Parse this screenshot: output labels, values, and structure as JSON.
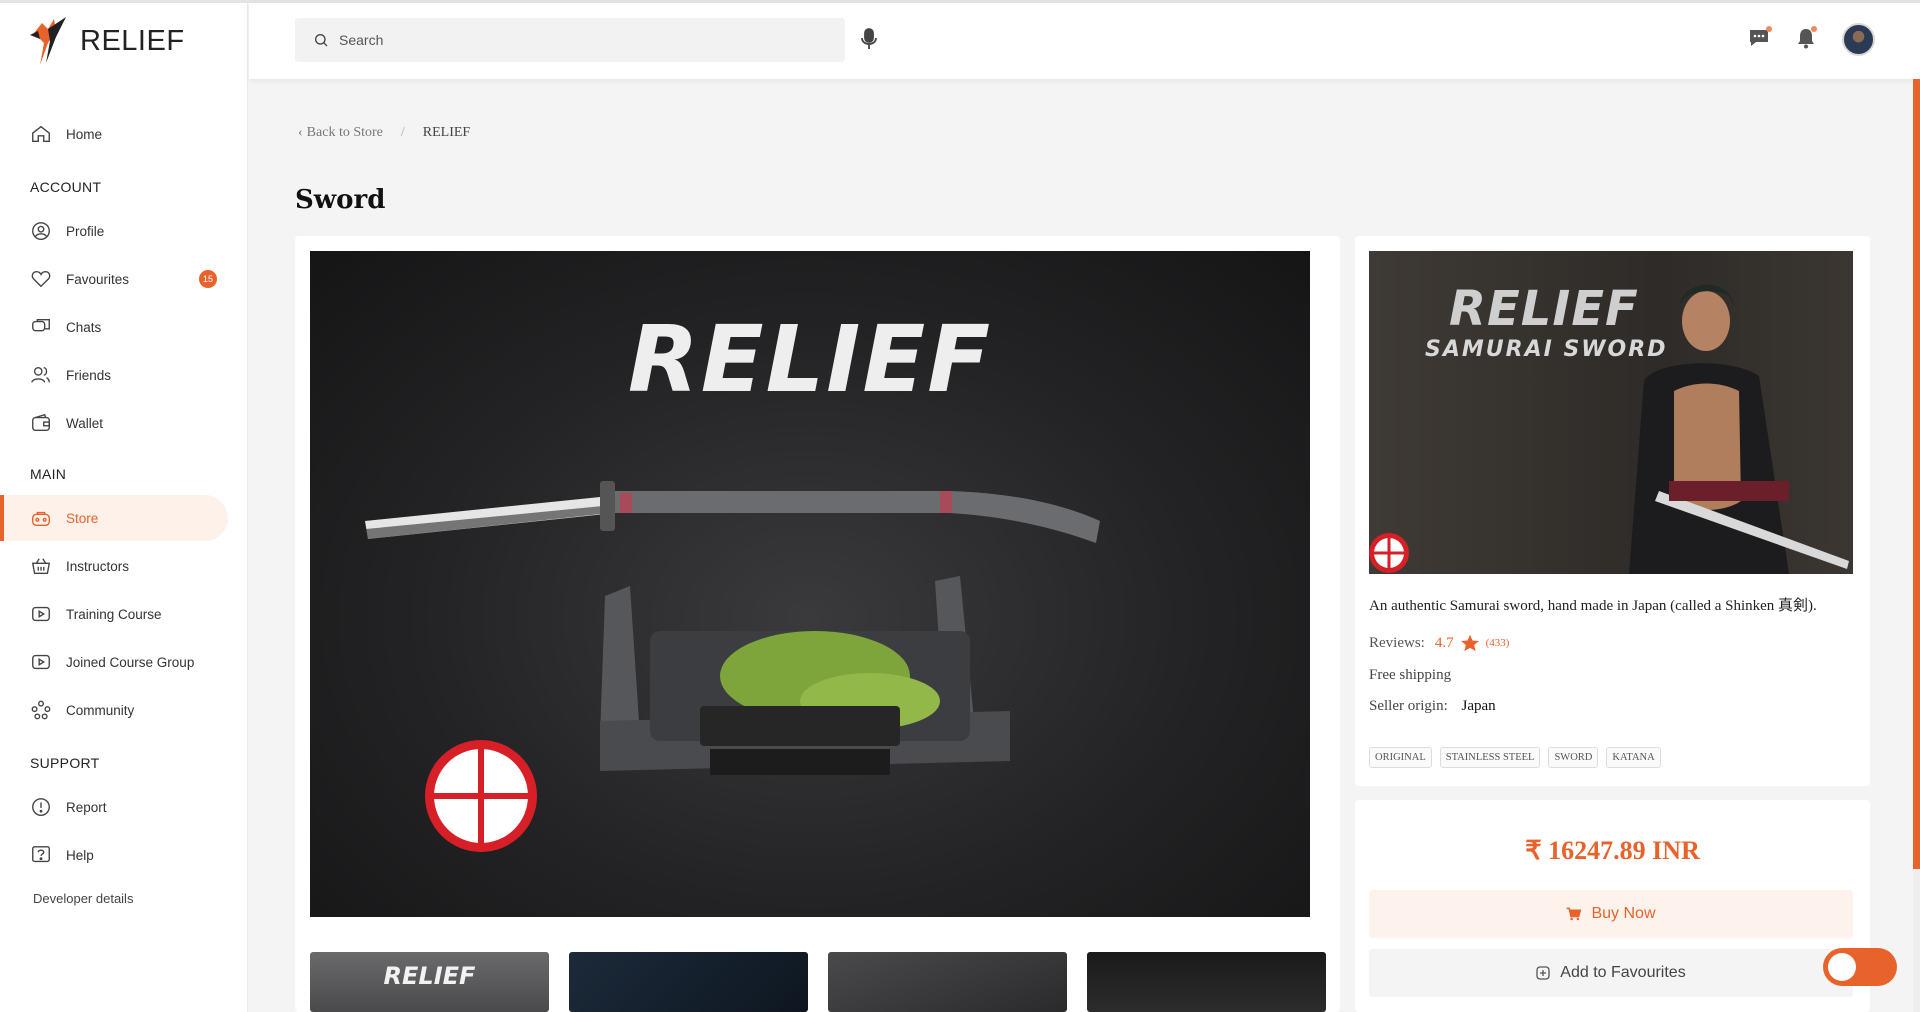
{
  "brand": {
    "name": "RELIEF"
  },
  "sidebar": {
    "home": "Home",
    "account_title": "ACCOUNT",
    "account": [
      {
        "label": "Profile"
      },
      {
        "label": "Favourites",
        "badge": "15"
      },
      {
        "label": "Chats"
      },
      {
        "label": "Friends"
      },
      {
        "label": "Wallet"
      }
    ],
    "main_title": "MAIN",
    "main": [
      {
        "label": "Store",
        "active": true
      },
      {
        "label": "Instructors"
      },
      {
        "label": "Training Course"
      },
      {
        "label": "Joined Course Group"
      },
      {
        "label": "Community"
      }
    ],
    "support_title": "SUPPORT",
    "support": [
      {
        "label": "Report"
      },
      {
        "label": "Help"
      }
    ],
    "developer": "Developer details"
  },
  "header": {
    "search_placeholder": "Search",
    "icons": [
      "search-icon",
      "mic-icon",
      "chat-icon",
      "bell-icon",
      "avatar"
    ]
  },
  "breadcrumb": {
    "back": "Back to Store",
    "current": "RELIEF"
  },
  "product": {
    "title": "Sword",
    "image_brand": "RELIEF",
    "thumb_brand": "RELIEF",
    "promo_brand": "RELIEF",
    "promo_sub": "SAMURAI SWORD",
    "description": "An authentic Samurai sword, hand made in Japan (called a Shinken 真剣).",
    "reviews_label": "Reviews:",
    "rating": "4.7",
    "review_count": "(433)",
    "shipping": "Free shipping",
    "origin_label": "Seller origin:",
    "origin": "Japan",
    "tags": [
      "ORIGINAL",
      "STAINLESS STEEL",
      "SWORD",
      "KATANA"
    ],
    "price": "₹ 16247.89 INR",
    "buy_label": "Buy Now",
    "fav_label": "Add to Favourites"
  },
  "colors": {
    "accent": "#e8632b",
    "accent_soft": "#fdf1ea"
  }
}
